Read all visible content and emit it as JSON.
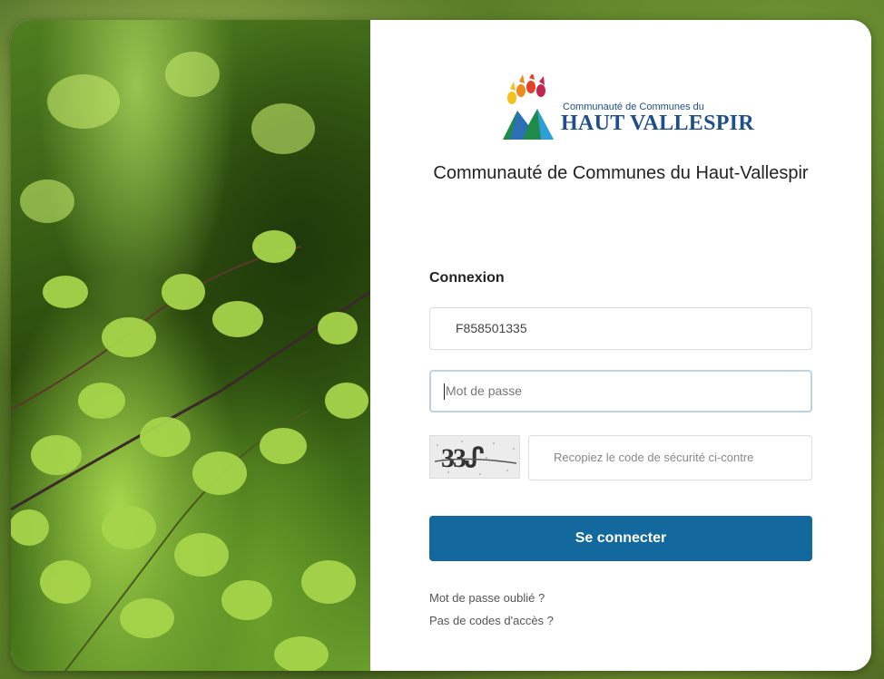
{
  "organization": {
    "logo_small": "Communauté de Communes du",
    "logo_large": "HAUT VALLESPIR",
    "name": "Communauté de Communes du Haut-Vallespir"
  },
  "login": {
    "title": "Connexion",
    "username_value": "F858501335",
    "password_placeholder": "Mot de passe",
    "captcha_text": "33ᔑ",
    "captcha_placeholder": "Recopiez le code de sécurité ci-contre",
    "submit_label": "Se connecter",
    "forgot_password": "Mot de passe oublié ?",
    "no_access_codes": "Pas de codes d'accès ?"
  },
  "colors": {
    "primary": "#13689e",
    "logo_blue": "#1e4f8a"
  }
}
